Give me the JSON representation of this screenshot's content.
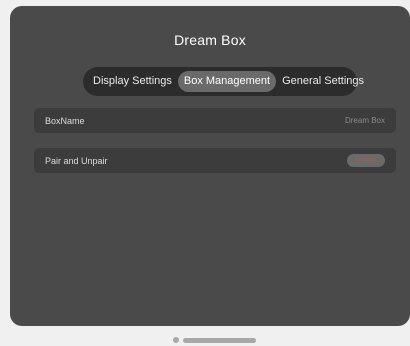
{
  "window": {
    "title": "Dream Box"
  },
  "tabs": [
    {
      "label": "Display Settings",
      "active": false
    },
    {
      "label": "Box Management",
      "active": true
    },
    {
      "label": "General Settings",
      "active": false
    }
  ],
  "rows": {
    "box_name": {
      "label": "BoxName",
      "value": "Dream Box"
    },
    "pair": {
      "label": "Pair and Unpair",
      "button_label": "Unpair"
    }
  },
  "colors": {
    "background": "#4a4a4a",
    "tab_bar": "#2c2c2c",
    "tab_active": "#6a6a6a",
    "row_bg": "#3c3c3c",
    "danger_text": "#d04a4a"
  },
  "pager": {
    "pages": 2,
    "current_page": 2
  }
}
